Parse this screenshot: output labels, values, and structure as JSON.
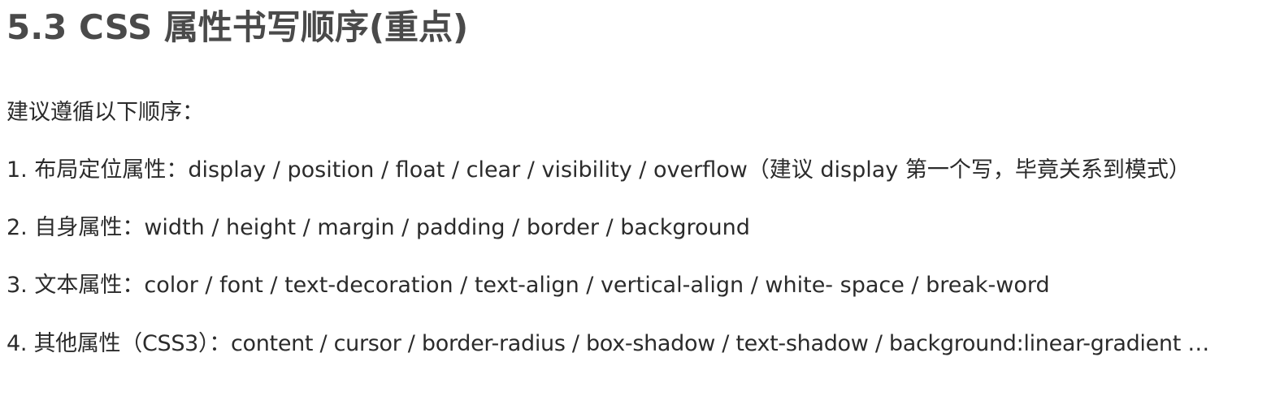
{
  "heading": "5.3 CSS 属性书写顺序(重点)",
  "intro": "建议遵循以下顺序：",
  "items": [
    "1. 布局定位属性：display / position / float / clear / visibility / overflow（建议 display 第一个写，毕竟关系到模式）",
    "2. 自身属性：width / height / margin / padding / border / background",
    "3. 文本属性：color / font / text-decoration / text-align / vertical-align / white- space / break-word",
    "4. 其他属性（CSS3）：content / cursor / border-radius / box-shadow / text-shadow / background:linear-gradient …"
  ]
}
